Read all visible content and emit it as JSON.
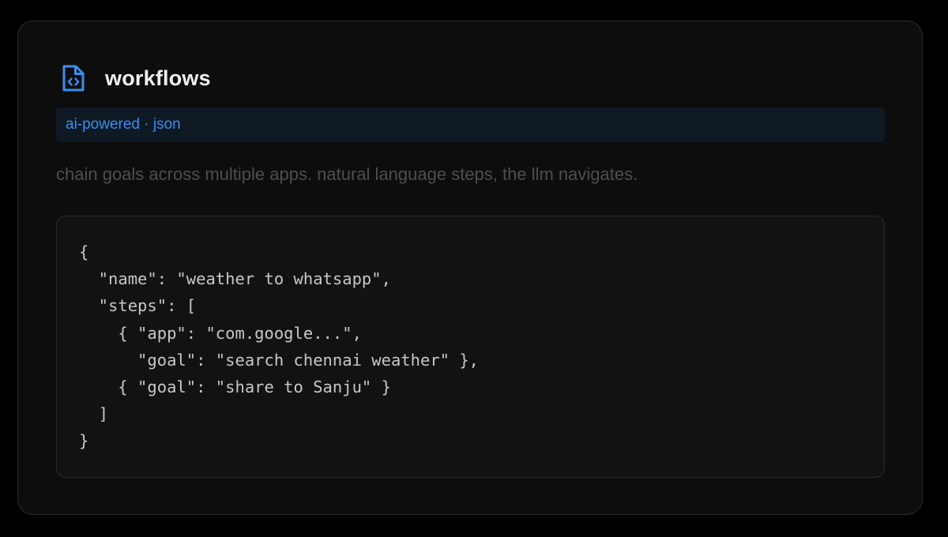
{
  "card": {
    "title": "workflows",
    "icon": "code-file-icon",
    "tag": "ai-powered · json",
    "description": "chain goals across multiple apps. natural language steps, the llm navigates.",
    "code_lines": [
      "{",
      "  \"name\": \"weather to whatsapp\",",
      "  \"steps\": [",
      "    { \"app\": \"com.google...\",",
      "      \"goal\": \"search chennai weather\" },",
      "    { \"goal\": \"share to Sanju\" }",
      "  ]",
      "}"
    ]
  },
  "colors": {
    "background": "#000000",
    "card_background": "#0d0d0d",
    "accent_blue": "#3b8ef0",
    "tag_background": "#0f1924",
    "code_text": "#c8c8c8",
    "description_text": "#4e4e4e"
  }
}
